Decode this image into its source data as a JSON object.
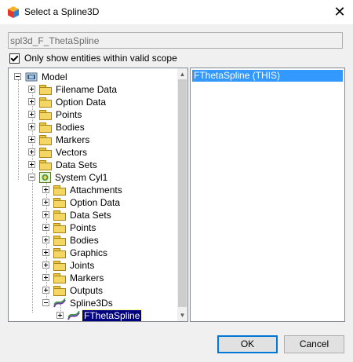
{
  "window": {
    "title": "Select a Spline3D",
    "close_glyph": "✕"
  },
  "name_field": {
    "value": "spl3d_F_ThetaSpline"
  },
  "scope_checkbox": {
    "label": "Only show entities within valid scope",
    "checked": true
  },
  "tree": {
    "model": "Model",
    "model_children": [
      "Filename Data",
      "Option Data",
      "Points",
      "Bodies",
      "Markers",
      "Vectors",
      "Data Sets"
    ],
    "system": "System Cyl1",
    "system_children": [
      "Attachments",
      "Option Data",
      "Data Sets",
      "Points",
      "Bodies",
      "Graphics",
      "Joints",
      "Markers",
      "Outputs"
    ],
    "spline_group": "Spline3Ds",
    "spline_item": "FThetaSpline"
  },
  "list": {
    "items": [
      "FThetaSpline (THIS)"
    ]
  },
  "buttons": {
    "ok": "OK",
    "cancel": "Cancel"
  }
}
